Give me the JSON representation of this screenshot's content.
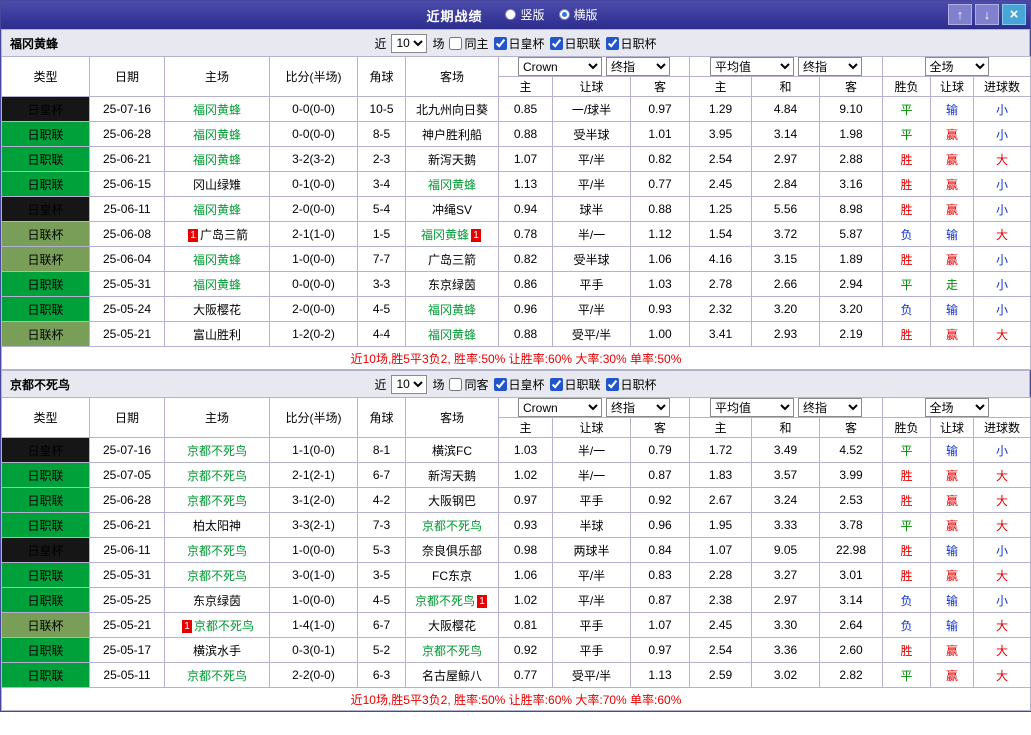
{
  "titlebar": {
    "title": "近期战绩",
    "options": [
      {
        "label": "竖版",
        "selected": false
      },
      {
        "label": "横版",
        "selected": true
      }
    ],
    "buttons": {
      "up": "↑",
      "down": "↓",
      "close": "×"
    }
  },
  "red_card_label": "1",
  "colors": {
    "type_bg": {
      "日皇杯": "#161616",
      "日职联": "#00a03a",
      "日联杯": "#789e58"
    },
    "result": {
      "胜": "#e60000",
      "赢": "#e60000",
      "大": "#e60000",
      "平": "#008a00",
      "走": "#008a00",
      "负": "#1133cc",
      "输": "#1133cc",
      "小": "#1133cc"
    },
    "score": "#e60000",
    "team_highlight": "#009933",
    "summary_text": "#e60000"
  },
  "table_header": {
    "static_cols": [
      "类型",
      "日期",
      "主场",
      "比分(半场)",
      "角球",
      "客场"
    ],
    "ah_group": {
      "selects": [
        "Crown",
        "终指"
      ],
      "cols": [
        "主",
        "让球",
        "客"
      ]
    },
    "eu_group": {
      "selects": [
        "平均值",
        "终指"
      ],
      "cols": [
        "主",
        "和",
        "客"
      ]
    },
    "res_group": {
      "select": "全场",
      "cols": [
        "胜负",
        "让球",
        "进球数"
      ]
    }
  },
  "sections": [
    {
      "team": "福冈黄蜂",
      "filter": {
        "near": "近",
        "count": "10",
        "games": "场",
        "same": {
          "label": "同主",
          "checked": false
        },
        "cups": [
          {
            "label": "日皇杯",
            "checked": true
          },
          {
            "label": "日职联",
            "checked": true
          },
          {
            "label": "日职杯",
            "checked": true
          }
        ]
      },
      "rows": [
        {
          "type": "日皇杯",
          "date": "25-07-16",
          "home": "福冈黄蜂",
          "home_hl": true,
          "home_card": false,
          "score": "0-0(0-0)",
          "corner": "10-5",
          "away": "北九州向日葵",
          "away_hl": false,
          "away_card": false,
          "ah": [
            "0.85",
            "一/球半",
            "0.97"
          ],
          "eu": [
            "1.29",
            "4.84",
            "9.10"
          ],
          "res": "平",
          "hres": "输",
          "goals": "小"
        },
        {
          "type": "日职联",
          "date": "25-06-28",
          "home": "福冈黄蜂",
          "home_hl": true,
          "home_card": false,
          "score": "0-0(0-0)",
          "corner": "8-5",
          "away": "神户胜利船",
          "away_hl": false,
          "away_card": false,
          "ah": [
            "0.88",
            "受半球",
            "1.01"
          ],
          "eu": [
            "3.95",
            "3.14",
            "1.98"
          ],
          "res": "平",
          "hres": "赢",
          "goals": "小"
        },
        {
          "type": "日职联",
          "date": "25-06-21",
          "home": "福冈黄蜂",
          "home_hl": true,
          "home_card": false,
          "score": "3-2(3-2)",
          "corner": "2-3",
          "away": "新泻天鹅",
          "away_hl": false,
          "away_card": false,
          "ah": [
            "1.07",
            "平/半",
            "0.82"
          ],
          "eu": [
            "2.54",
            "2.97",
            "2.88"
          ],
          "res": "胜",
          "hres": "赢",
          "goals": "大"
        },
        {
          "type": "日职联",
          "date": "25-06-15",
          "home": "冈山绿雉",
          "home_hl": false,
          "home_card": false,
          "score": "0-1(0-0)",
          "corner": "3-4",
          "away": "福冈黄蜂",
          "away_hl": true,
          "away_card": false,
          "ah": [
            "1.13",
            "平/半",
            "0.77"
          ],
          "eu": [
            "2.45",
            "2.84",
            "3.16"
          ],
          "res": "胜",
          "hres": "赢",
          "goals": "小"
        },
        {
          "type": "日皇杯",
          "date": "25-06-11",
          "home": "福冈黄蜂",
          "home_hl": true,
          "home_card": false,
          "score": "2-0(0-0)",
          "corner": "5-4",
          "away": "冲绳SV",
          "away_hl": false,
          "away_card": false,
          "ah": [
            "0.94",
            "球半",
            "0.88"
          ],
          "eu": [
            "1.25",
            "5.56",
            "8.98"
          ],
          "res": "胜",
          "hres": "赢",
          "goals": "小"
        },
        {
          "type": "日联杯",
          "date": "25-06-08",
          "home": "广岛三箭",
          "home_hl": false,
          "home_card": true,
          "score": "2-1(1-0)",
          "corner": "1-5",
          "away": "福冈黄蜂",
          "away_hl": true,
          "away_card": true,
          "ah": [
            "0.78",
            "半/一",
            "1.12"
          ],
          "eu": [
            "1.54",
            "3.72",
            "5.87"
          ],
          "res": "负",
          "hres": "输",
          "goals": "大"
        },
        {
          "type": "日联杯",
          "date": "25-06-04",
          "home": "福冈黄蜂",
          "home_hl": true,
          "home_card": false,
          "score": "1-0(0-0)",
          "corner": "7-7",
          "away": "广岛三箭",
          "away_hl": false,
          "away_card": false,
          "ah": [
            "0.82",
            "受半球",
            "1.06"
          ],
          "eu": [
            "4.16",
            "3.15",
            "1.89"
          ],
          "res": "胜",
          "hres": "赢",
          "goals": "小"
        },
        {
          "type": "日职联",
          "date": "25-05-31",
          "home": "福冈黄蜂",
          "home_hl": true,
          "home_card": false,
          "score": "0-0(0-0)",
          "corner": "3-3",
          "away": "东京绿茵",
          "away_hl": false,
          "away_card": false,
          "ah": [
            "0.86",
            "平手",
            "1.03"
          ],
          "eu": [
            "2.78",
            "2.66",
            "2.94"
          ],
          "res": "平",
          "hres": "走",
          "goals": "小"
        },
        {
          "type": "日职联",
          "date": "25-05-24",
          "home": "大阪樱花",
          "home_hl": false,
          "home_card": false,
          "score": "2-0(0-0)",
          "corner": "4-5",
          "away": "福冈黄蜂",
          "away_hl": true,
          "away_card": false,
          "ah": [
            "0.96",
            "平/半",
            "0.93"
          ],
          "eu": [
            "2.32",
            "3.20",
            "3.20"
          ],
          "res": "负",
          "hres": "输",
          "goals": "小"
        },
        {
          "type": "日联杯",
          "date": "25-05-21",
          "home": "富山胜利",
          "home_hl": false,
          "home_card": false,
          "score": "1-2(0-2)",
          "corner": "4-4",
          "away": "福冈黄蜂",
          "away_hl": true,
          "away_card": false,
          "ah": [
            "0.88",
            "受平/半",
            "1.00"
          ],
          "eu": [
            "3.41",
            "2.93",
            "2.19"
          ],
          "res": "胜",
          "hres": "赢",
          "goals": "大"
        }
      ],
      "summary": "近10场,胜5平3负2, 胜率:50%  让胜率:60%  大率:30%  单率:50%"
    },
    {
      "team": "京都不死鸟",
      "filter": {
        "near": "近",
        "count": "10",
        "games": "场",
        "same": {
          "label": "同客",
          "checked": false
        },
        "cups": [
          {
            "label": "日皇杯",
            "checked": true
          },
          {
            "label": "日职联",
            "checked": true
          },
          {
            "label": "日职杯",
            "checked": true
          }
        ]
      },
      "rows": [
        {
          "type": "日皇杯",
          "date": "25-07-16",
          "home": "京都不死鸟",
          "home_hl": true,
          "home_card": false,
          "score": "1-1(0-0)",
          "corner": "8-1",
          "away": "横滨FC",
          "away_hl": false,
          "away_card": false,
          "ah": [
            "1.03",
            "半/一",
            "0.79"
          ],
          "eu": [
            "1.72",
            "3.49",
            "4.52"
          ],
          "res": "平",
          "hres": "输",
          "goals": "小"
        },
        {
          "type": "日职联",
          "date": "25-07-05",
          "home": "京都不死鸟",
          "home_hl": true,
          "home_card": false,
          "score": "2-1(2-1)",
          "corner": "6-7",
          "away": "新泻天鹅",
          "away_hl": false,
          "away_card": false,
          "ah": [
            "1.02",
            "半/一",
            "0.87"
          ],
          "eu": [
            "1.83",
            "3.57",
            "3.99"
          ],
          "res": "胜",
          "hres": "赢",
          "goals": "大"
        },
        {
          "type": "日职联",
          "date": "25-06-28",
          "home": "京都不死鸟",
          "home_hl": true,
          "home_card": false,
          "score": "3-1(2-0)",
          "corner": "4-2",
          "away": "大阪钢巴",
          "away_hl": false,
          "away_card": false,
          "ah": [
            "0.97",
            "平手",
            "0.92"
          ],
          "eu": [
            "2.67",
            "3.24",
            "2.53"
          ],
          "res": "胜",
          "hres": "赢",
          "goals": "大"
        },
        {
          "type": "日职联",
          "date": "25-06-21",
          "home": "柏太阳神",
          "home_hl": false,
          "home_card": false,
          "score": "3-3(2-1)",
          "corner": "7-3",
          "away": "京都不死鸟",
          "away_hl": true,
          "away_card": false,
          "ah": [
            "0.93",
            "半球",
            "0.96"
          ],
          "eu": [
            "1.95",
            "3.33",
            "3.78"
          ],
          "res": "平",
          "hres": "赢",
          "goals": "大"
        },
        {
          "type": "日皇杯",
          "date": "25-06-11",
          "home": "京都不死鸟",
          "home_hl": true,
          "home_card": false,
          "score": "1-0(0-0)",
          "corner": "5-3",
          "away": "奈良俱乐部",
          "away_hl": false,
          "away_card": false,
          "ah": [
            "0.98",
            "两球半",
            "0.84"
          ],
          "eu": [
            "1.07",
            "9.05",
            "22.98"
          ],
          "res": "胜",
          "hres": "输",
          "goals": "小"
        },
        {
          "type": "日职联",
          "date": "25-05-31",
          "home": "京都不死鸟",
          "home_hl": true,
          "home_card": false,
          "score": "3-0(1-0)",
          "corner": "3-5",
          "away": "FC东京",
          "away_hl": false,
          "away_card": false,
          "ah": [
            "1.06",
            "平/半",
            "0.83"
          ],
          "eu": [
            "2.28",
            "3.27",
            "3.01"
          ],
          "res": "胜",
          "hres": "赢",
          "goals": "大"
        },
        {
          "type": "日职联",
          "date": "25-05-25",
          "home": "东京绿茵",
          "home_hl": false,
          "home_card": false,
          "score": "1-0(0-0)",
          "corner": "4-5",
          "away": "京都不死鸟",
          "away_hl": true,
          "away_card": true,
          "ah": [
            "1.02",
            "平/半",
            "0.87"
          ],
          "eu": [
            "2.38",
            "2.97",
            "3.14"
          ],
          "res": "负",
          "hres": "输",
          "goals": "小"
        },
        {
          "type": "日联杯",
          "date": "25-05-21",
          "home": "京都不死鸟",
          "home_hl": true,
          "home_card": true,
          "score": "1-4(1-0)",
          "corner": "6-7",
          "away": "大阪樱花",
          "away_hl": false,
          "away_card": false,
          "ah": [
            "0.81",
            "平手",
            "1.07"
          ],
          "eu": [
            "2.45",
            "3.30",
            "2.64"
          ],
          "res": "负",
          "hres": "输",
          "goals": "大"
        },
        {
          "type": "日职联",
          "date": "25-05-17",
          "home": "横滨水手",
          "home_hl": false,
          "home_card": false,
          "score": "0-3(0-1)",
          "corner": "5-2",
          "away": "京都不死鸟",
          "away_hl": true,
          "away_card": false,
          "ah": [
            "0.92",
            "平手",
            "0.97"
          ],
          "eu": [
            "2.54",
            "3.36",
            "2.60"
          ],
          "res": "胜",
          "hres": "赢",
          "goals": "大"
        },
        {
          "type": "日职联",
          "date": "25-05-11",
          "home": "京都不死鸟",
          "home_hl": true,
          "home_card": false,
          "score": "2-2(0-0)",
          "corner": "6-3",
          "away": "名古屋鲸八",
          "away_hl": false,
          "away_card": false,
          "ah": [
            "0.77",
            "受平/半",
            "1.13"
          ],
          "eu": [
            "2.59",
            "3.02",
            "2.82"
          ],
          "res": "平",
          "hres": "赢",
          "goals": "大"
        }
      ],
      "summary": "近10场,胜5平3负2, 胜率:50%  让胜率:60%  大率:70%  单率:60%"
    }
  ]
}
